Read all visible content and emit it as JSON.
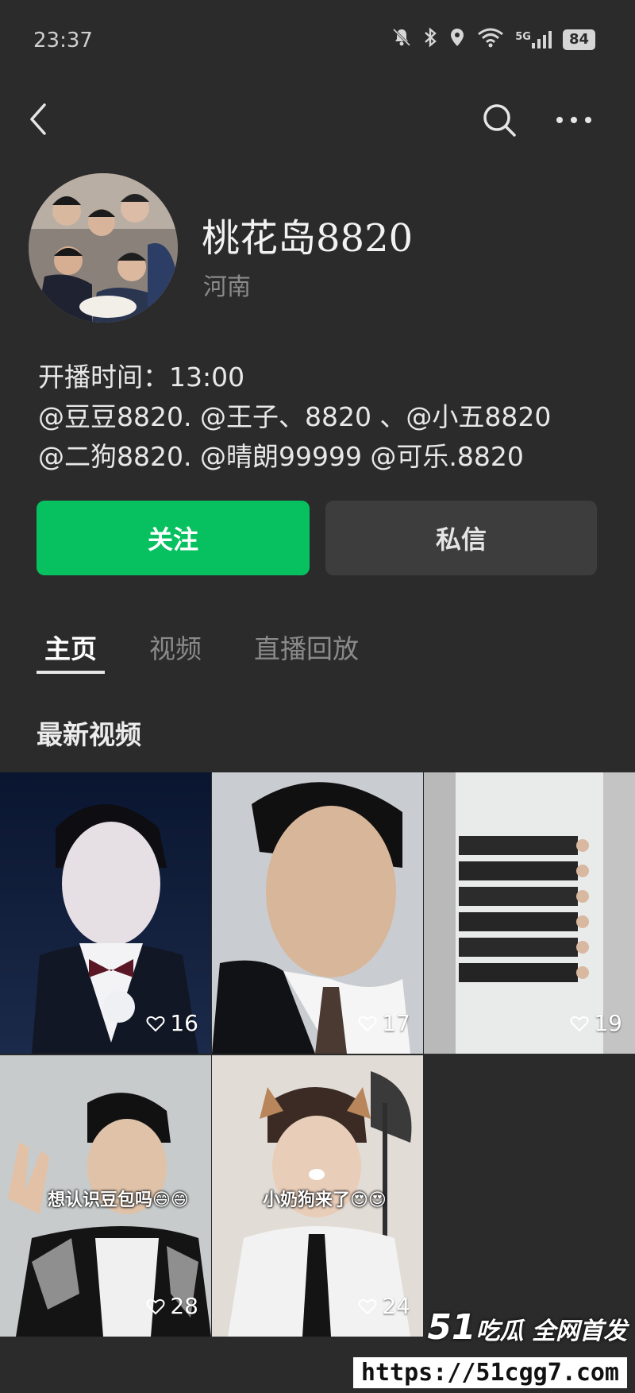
{
  "status_bar": {
    "time": "23:37",
    "network_label": "5G",
    "battery": "84"
  },
  "nav": {
    "back_icon": "chevron-left-icon",
    "search_icon": "search-icon",
    "more_icon": "more-icon"
  },
  "profile": {
    "name": "桃花岛8820",
    "location": "河南"
  },
  "bio": {
    "lines": [
      "开播时间：13:00",
      "@豆豆8820. @王子、8820 、@小五8820",
      "@二狗8820. @晴朗99999 @可乐.8820"
    ]
  },
  "actions": {
    "follow_label": "关注",
    "message_label": "私信",
    "follow_color": "#07c160"
  },
  "tabs": [
    {
      "label": "主页",
      "active": true
    },
    {
      "label": "视频",
      "active": false
    },
    {
      "label": "直播回放",
      "active": false
    }
  ],
  "section": {
    "title": "最新视频"
  },
  "videos": [
    {
      "likes": "16",
      "caption": ""
    },
    {
      "likes": "17",
      "caption": ""
    },
    {
      "likes": "19",
      "caption": ""
    },
    {
      "likes": "28",
      "caption": "想认识豆包吗😄😄"
    },
    {
      "likes": "24",
      "caption": "小奶狗来了😍😍"
    }
  ],
  "watermark": {
    "brand_number": "51",
    "brand_text": "吃瓜 全网首发",
    "url": "https://51cgg7.com"
  }
}
